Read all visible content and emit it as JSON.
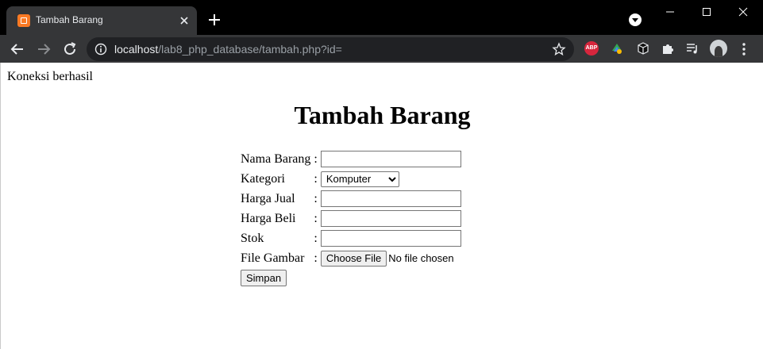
{
  "browser": {
    "tab_title": "Tambah Barang",
    "url_host": "localhost",
    "url_path": "/lab8_php_database/tambah.php?id=",
    "extensions": [
      "ABP",
      "extension-icon",
      "cube-icon",
      "puzzle-icon",
      "media-control-icon"
    ]
  },
  "page": {
    "status_text": "Koneksi berhasil",
    "title": "Tambah Barang"
  },
  "form": {
    "separator": ":",
    "fields": [
      {
        "label": "Nama Barang",
        "type": "text",
        "value": ""
      },
      {
        "label": "Kategori",
        "type": "select",
        "value": "Komputer",
        "options": [
          "Komputer"
        ]
      },
      {
        "label": "Harga Jual",
        "type": "text",
        "value": ""
      },
      {
        "label": "Harga Beli",
        "type": "text",
        "value": ""
      },
      {
        "label": "Stok",
        "type": "text",
        "value": ""
      },
      {
        "label": "File Gambar",
        "type": "file",
        "button_label": "Choose File",
        "file_status": "No file chosen"
      }
    ],
    "submit_label": "Simpan"
  }
}
